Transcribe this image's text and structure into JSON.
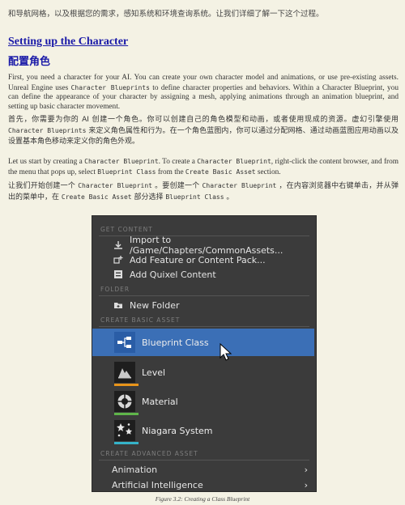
{
  "top_line": "和导航网格，以及根据您的需求，感知系统和环境查询系统。让我们详细了解一下这个过程。",
  "heading_en": "Setting up the Character",
  "heading_zh": "配置角色",
  "para1": [
    "First, you need a character for your AI. You can create your own character model and animations, or use pre-existing assets. Unreal Engine uses ",
    "Character Blueprints",
    " to define character properties and behaviors. Within a Character Blueprint, you can define the appearance of your character by assigning a mesh, applying animations through an animation blueprint, and setting up basic character movement."
  ],
  "para1_zh": [
    "首先，你需要为你的 AI 创建一个角色。你可以创建自己的角色模型和动画，或者使用现成的资源。虚幻引擎使用 ",
    "Character Blueprints",
    " 来定义角色属性和行为。在一个角色蓝图内，你可以通过分配网格、通过动画蓝图应用动画以及设置基本角色移动来定义你的角色外观。"
  ],
  "para2": [
    "Let us start by creating a ",
    "Character Blueprint",
    ". To create a ",
    "Character Blueprint",
    ", right-click the content browser, and from the menu that pops up, select ",
    "Blueprint Class",
    " from the ",
    "Create Basic Asset",
    " section."
  ],
  "para2_zh": [
    "让我们开始创建一个 ",
    "Character Blueprint",
    " 。要创建一个 ",
    "Character Blueprint",
    " ，在内容浏览器中右键单击，并从弹出的菜单中，在 ",
    "Create Basic Asset",
    " 部分选择 ",
    "Blueprint Class",
    " 。"
  ],
  "menu": {
    "sections": {
      "get_content": "GET CONTENT",
      "folder": "FOLDER",
      "create_basic": "CREATE BASIC ASSET",
      "create_advanced": "CREATE ADVANCED ASSET"
    },
    "items": {
      "import": "Import to /Game/Chapters/CommonAssets...",
      "add_feature": "Add Feature or Content Pack...",
      "add_quixel": "Add Quixel Content",
      "new_folder": "New Folder"
    },
    "assets": [
      {
        "label": "Blueprint Class",
        "bar_color": "",
        "icon": "blueprint-icon"
      },
      {
        "label": "Level",
        "bar_color": "#e8941a",
        "icon": "level-icon"
      },
      {
        "label": "Material",
        "bar_color": "#5fb54a",
        "icon": "material-icon"
      },
      {
        "label": "Niagara System",
        "bar_color": "#35b3c9",
        "icon": "niagara-icon"
      }
    ],
    "submenus": [
      {
        "label": "Animation",
        "arrow": "›"
      },
      {
        "label": "Artificial Intelligence",
        "arrow": "›"
      }
    ]
  },
  "caption": "Figure 3.2: Creating a Class Blueprint"
}
